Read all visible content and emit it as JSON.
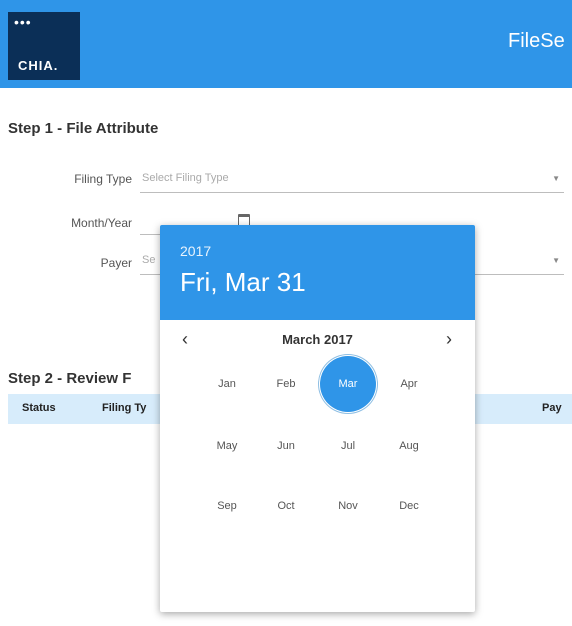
{
  "header": {
    "logo_text": "CHIA.",
    "logo_dots": "•••",
    "app_title": "FileSe"
  },
  "step1": {
    "title": "Step 1 - File Attribute",
    "filing_type": {
      "label": "Filing Type",
      "placeholder": "Select Filing Type"
    },
    "month_year": {
      "label": "Month/Year"
    },
    "payer": {
      "label": "Payer",
      "placeholder": "Se"
    }
  },
  "step2": {
    "title": "Step 2 - Review F",
    "columns": [
      "Status",
      "Filing Ty",
      "Pay"
    ]
  },
  "datepicker": {
    "year": "2017",
    "selected_date": "Fri, Mar 31",
    "nav_label": "March 2017",
    "prev_icon": "‹",
    "next_icon": "›",
    "months": [
      "Jan",
      "Feb",
      "Mar",
      "Apr",
      "May",
      "Jun",
      "Jul",
      "Aug",
      "Sep",
      "Oct",
      "Nov",
      "Dec"
    ],
    "selected_month": "Mar"
  },
  "colors": {
    "accent": "#2f95e8",
    "logo_bg": "#0b2f57",
    "table_header": "#d7ecfb"
  }
}
